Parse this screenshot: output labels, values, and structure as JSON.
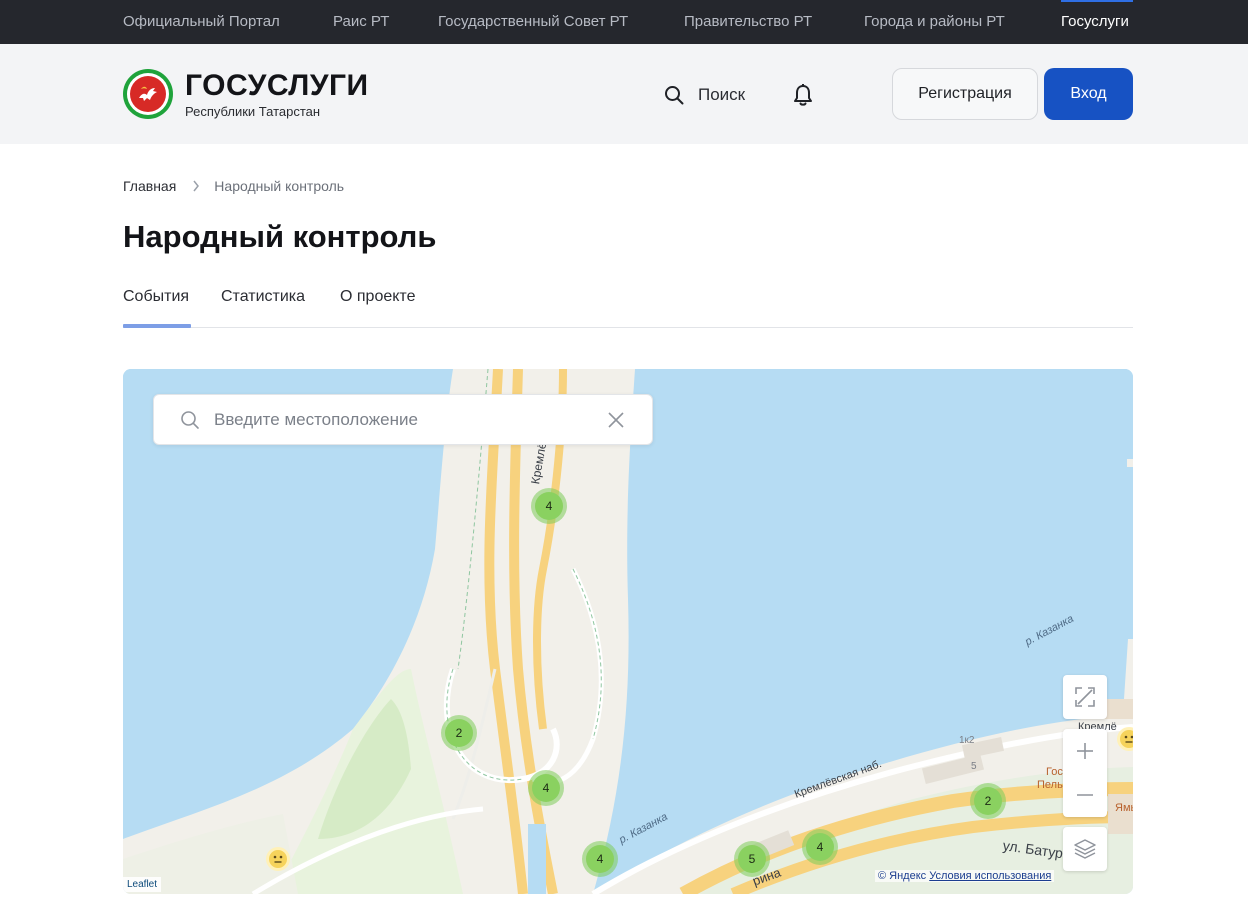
{
  "topnav": {
    "links": [
      "Официальный Портал",
      "Раис РТ",
      "Государственный Совет РТ",
      "Правительство РТ",
      "Города и районы РТ",
      "Госуслуги"
    ],
    "active_index": 5,
    "bg": "#25272d"
  },
  "header": {
    "logo_title": "ГОСУСЛУГИ",
    "logo_subtitle": "Республики Татарстан",
    "logo_icon": "tatarstan-emblem-icon",
    "search_label": "Поиск",
    "search_icon": "search-icon",
    "bell_icon": "bell-icon",
    "register_label": "Регистрация",
    "login_label": "Вход",
    "accent": "#1752c3"
  },
  "breadcrumb": {
    "home": "Главная",
    "current": "Народный контроль",
    "separator_icon": "chevron-right-icon"
  },
  "page": {
    "title": "Народный контроль"
  },
  "tabs": [
    {
      "label": "События",
      "active": true
    },
    {
      "label": "Статистика",
      "active": false
    },
    {
      "label": "О проекте",
      "active": false
    }
  ],
  "map": {
    "search_placeholder": "Введите местоположение",
    "search_value": "",
    "clear_icon": "close-icon",
    "clusters": [
      {
        "count": "4"
      },
      {
        "count": "2"
      },
      {
        "count": "4"
      },
      {
        "count": "4"
      },
      {
        "count": "5"
      },
      {
        "count": "4"
      },
      {
        "count": "2"
      }
    ],
    "street_labels": {
      "kremlevskaya_dam": "Кремлёвская д",
      "kremlevskaya_emb": "Кремлёвская наб.",
      "baturina": "ул. Батурина",
      "kazanka_1": "р. Казанка",
      "kazanka_2": "р. Казанка",
      "bldg_1k2": "1к2",
      "bldg_5": "5",
      "kreml_edge": "Кремлё",
      "poi_gos": "Гос",
      "poi_pel": "Пель",
      "poi_yam": "Ямь",
      "rina": "рина"
    },
    "controls": {
      "fullscreen_icon": "fullscreen-icon",
      "zoom_in_icon": "plus-icon",
      "zoom_out_icon": "minus-icon",
      "layers_icon": "layers-icon"
    },
    "attribution_leaflet": "Leaflet",
    "attribution_copy": "© Яндекс",
    "attribution_terms": "Условия использования",
    "colors": {
      "water": "#b6dcf3",
      "land": "#f2f0ea",
      "park": "#dcefd0",
      "road": "#f7d27e",
      "cluster": "#8ad160"
    }
  }
}
